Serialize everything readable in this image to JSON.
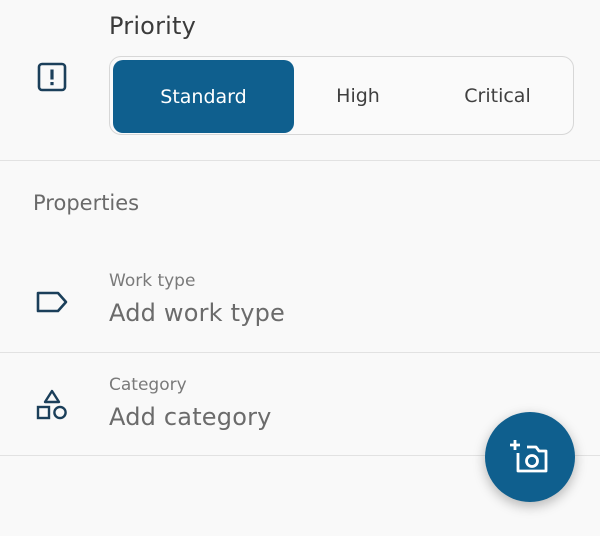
{
  "priority": {
    "title": "Priority",
    "options": [
      "Standard",
      "High",
      "Critical"
    ],
    "selected": "Standard"
  },
  "properties": {
    "title": "Properties",
    "work_type": {
      "label": "Work type",
      "placeholder": "Add work type"
    },
    "category": {
      "label": "Category",
      "placeholder": "Add category"
    }
  },
  "fab": {
    "icon": "add-photo-icon"
  },
  "colors": {
    "accent": "#0f5f8e",
    "background": "#f9f9f9",
    "divider": "#e2e2e2"
  },
  "icons": {
    "priority": "exclamation-square-icon",
    "work_type": "tag-icon",
    "category": "shapes-icon"
  }
}
